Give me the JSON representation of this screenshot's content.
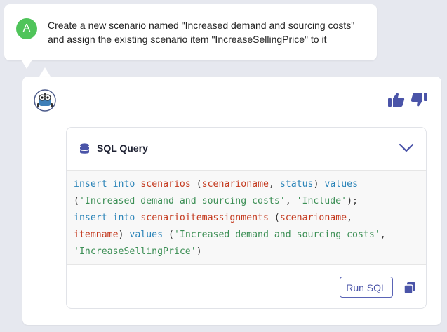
{
  "user_message": {
    "avatar_letter": "A",
    "line1": "Create a new scenario named \"Increased demand and sourcing costs\"",
    "line2": "and assign the existing scenario item \"IncreaseSellingPrice\" to it"
  },
  "reply": {
    "sql_panel": {
      "title": "SQL Query",
      "code_lines": [
        [
          {
            "cls": "kw",
            "t": "insert"
          },
          {
            "cls": "",
            "t": " "
          },
          {
            "cls": "kw",
            "t": "into"
          },
          {
            "cls": "",
            "t": " "
          },
          {
            "cls": "id",
            "t": "scenarios"
          },
          {
            "cls": "",
            "t": " ("
          },
          {
            "cls": "id",
            "t": "scenarioname"
          },
          {
            "cls": "",
            "t": ", "
          },
          {
            "cls": "kw",
            "t": "status"
          },
          {
            "cls": "",
            "t": ") "
          },
          {
            "cls": "kw",
            "t": "values"
          }
        ],
        [
          {
            "cls": "",
            "t": "("
          },
          {
            "cls": "str",
            "t": "'Increased demand and sourcing costs'"
          },
          {
            "cls": "",
            "t": ", "
          },
          {
            "cls": "str",
            "t": "'Include'"
          },
          {
            "cls": "",
            "t": ");"
          }
        ],
        [
          {
            "cls": "kw",
            "t": "insert"
          },
          {
            "cls": "",
            "t": " "
          },
          {
            "cls": "kw",
            "t": "into"
          },
          {
            "cls": "",
            "t": " "
          },
          {
            "cls": "id",
            "t": "scenarioitemassignments"
          },
          {
            "cls": "",
            "t": " ("
          },
          {
            "cls": "id",
            "t": "scenarioname"
          },
          {
            "cls": "",
            "t": ","
          }
        ],
        [
          {
            "cls": "id",
            "t": "itemname"
          },
          {
            "cls": "",
            "t": ") "
          },
          {
            "cls": "kw",
            "t": "values"
          },
          {
            "cls": "",
            "t": " ("
          },
          {
            "cls": "str",
            "t": "'Increased demand and sourcing costs'"
          },
          {
            "cls": "",
            "t": ","
          }
        ],
        [
          {
            "cls": "str",
            "t": "'IncreaseSellingPrice'"
          },
          {
            "cls": "",
            "t": ")"
          }
        ]
      ],
      "run_button_label": "Run SQL"
    }
  },
  "icons": {
    "bot_avatar": "robot-avatar-icon",
    "like": "thumbs-up-icon",
    "dislike": "thumbs-down-icon",
    "database": "database-icon",
    "collapse": "chevron-down-icon",
    "copy": "copy-icon"
  },
  "colors": {
    "accent": "#4a54a8",
    "user_avatar": "#4fc45a",
    "keyword": "#2b84b8",
    "identifier": "#c43a1f",
    "string": "#3c8f55"
  }
}
